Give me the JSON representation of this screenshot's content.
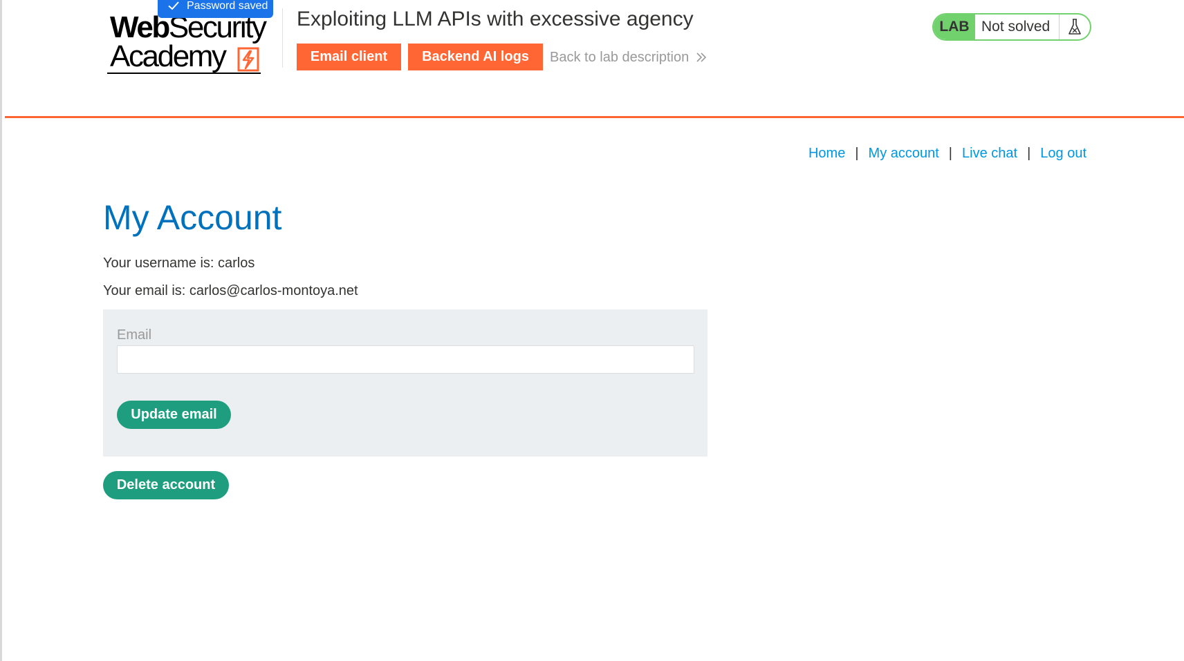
{
  "header": {
    "logo": {
      "line1_bold": "Web",
      "line1_rest": "Security",
      "line2": "Academy"
    },
    "password_toast": "Password saved",
    "lab_title": "Exploiting LLM APIs with excessive agency",
    "buttons": {
      "email_client": "Email client",
      "backend_ai_logs": "Backend AI logs"
    },
    "back_link": "Back to lab description",
    "lab_status": {
      "tag": "LAB",
      "state": "Not solved"
    }
  },
  "nav": {
    "home": "Home",
    "my_account": "My account",
    "live_chat": "Live chat",
    "log_out": "Log out",
    "separator": "|"
  },
  "main": {
    "title": "My Account",
    "username_line": "Your username is: carlos",
    "email_line": "Your email is: carlos@carlos-montoya.net",
    "form": {
      "email_label": "Email",
      "email_value": "",
      "update_button": "Update email"
    },
    "delete_button": "Delete account"
  },
  "colors": {
    "accent_orange": "#ff6633",
    "lab_green": "#70d16d",
    "link_blue": "#0096e0",
    "title_blue": "#0071bc",
    "button_green": "#1e9e7e",
    "toast_blue": "#1a73e8"
  },
  "icons": {
    "toast": "checkmark-icon",
    "back_link": "double-chevron-right-icon",
    "lab_status": "flask-icon",
    "logo": "lightning-bolt-icon"
  }
}
